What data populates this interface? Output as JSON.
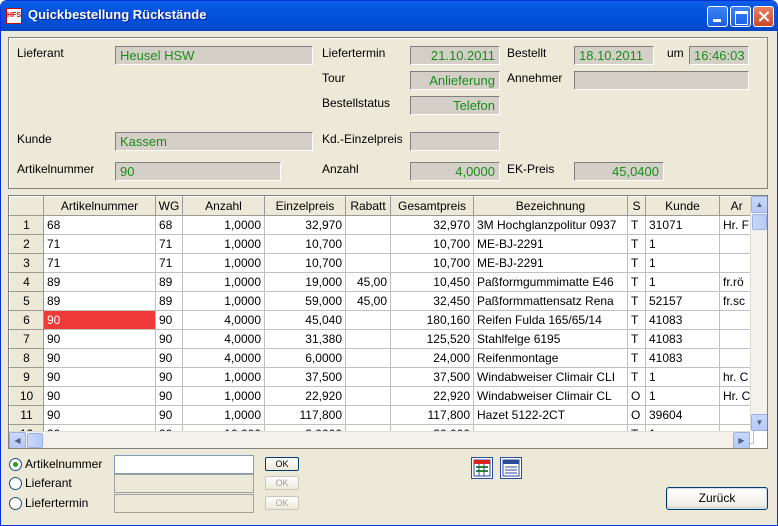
{
  "window": {
    "title": "Quickbestellung Rückstände",
    "icon_text": "HFS"
  },
  "header": {
    "lieferant_label": "Lieferant",
    "lieferant_value": "Heusel HSW",
    "liefertermin_label": "Liefertermin",
    "liefertermin_value": "21.10.2011",
    "bestellt_label": "Bestellt",
    "bestellt_date": "18.10.2011",
    "um_label": "um",
    "bestellt_time": "16:46:03",
    "tour_label": "Tour",
    "tour_value": "Anlieferung",
    "annehmer_label": "Annehmer",
    "annehmer_value": "",
    "bestellstatus_label": "Bestellstatus",
    "bestellstatus_value": "Telefon",
    "kunde_label": "Kunde",
    "kunde_value": "Kassem",
    "kd_einzelpreis_label": "Kd.-Einzelpreis",
    "kd_einzelpreis_value": "",
    "artikelnummer_label": "Artikelnummer",
    "artikelnummer_value": "90",
    "anzahl_label": "Anzahl",
    "anzahl_value": "4,0000",
    "ek_preis_label": "EK-Preis",
    "ek_preis_value": "45,0400"
  },
  "grid": {
    "columns": [
      "",
      "Artikelnummer",
      "WG",
      "Anzahl",
      "Einzelpreis",
      "Rabatt",
      "Gesamtpreis",
      "Bezeichnung",
      "S",
      "Kunde",
      "Ar"
    ],
    "rows": [
      [
        "1",
        "68",
        "68",
        "1,0000",
        "32,970",
        "",
        "32,970",
        "3M Hochglanzpolitur 0937",
        "T",
        "31071",
        "Hr. F"
      ],
      [
        "2",
        "71",
        "71",
        "1,0000",
        "10,700",
        "",
        "10,700",
        "ME-BJ-2291",
        "T",
        "1",
        ""
      ],
      [
        "3",
        "71",
        "71",
        "1,0000",
        "10,700",
        "",
        "10,700",
        "ME-BJ-2291",
        "T",
        "1",
        ""
      ],
      [
        "4",
        "89",
        "89",
        "1,0000",
        "19,000",
        "45,00",
        "10,450",
        "Paßformgummimatte E46",
        "T",
        "1",
        "fr.rö"
      ],
      [
        "5",
        "89",
        "89",
        "1,0000",
        "59,000",
        "45,00",
        "32,450",
        "Paßformmattensatz Rena",
        "T",
        "52157",
        "fr.sc"
      ],
      [
        "6",
        "90",
        "90",
        "4,0000",
        "45,040",
        "",
        "180,160",
        "Reifen Fulda 165/65/14",
        "T",
        "41083",
        ""
      ],
      [
        "7",
        "90",
        "90",
        "4,0000",
        "31,380",
        "",
        "125,520",
        "Stahlfelge 6195",
        "T",
        "41083",
        ""
      ],
      [
        "8",
        "90",
        "90",
        "4,0000",
        "6,0000",
        "",
        "24,000",
        "Reifenmontage",
        "T",
        "41083",
        ""
      ],
      [
        "9",
        "90",
        "90",
        "1,0000",
        "37,500",
        "",
        "37,500",
        "Windabweiser Climair CLI",
        "T",
        "1",
        "hr. C"
      ],
      [
        "10",
        "90",
        "90",
        "1,0000",
        "22,920",
        "",
        "22,920",
        "Windabweiser Climair  CL",
        "O",
        "1",
        "Hr. C"
      ],
      [
        "11",
        "90",
        "90",
        "1,0000",
        "117,800",
        "",
        "117,800",
        "Hazet 5122-2CT",
        "O",
        "39604",
        ""
      ],
      [
        "12",
        "90",
        "90",
        "10,000",
        "3,0000",
        "",
        "30,000",
        "",
        "T",
        "1",
        ""
      ]
    ],
    "selected_row": 6
  },
  "search": {
    "options": [
      {
        "label": "Artikelnummer",
        "checked": true,
        "value": ""
      },
      {
        "label": "Lieferant",
        "checked": false,
        "value": ""
      },
      {
        "label": "Liefertermin",
        "checked": false,
        "value": ""
      }
    ],
    "ok_label": "OK"
  },
  "footer": {
    "zurueck_label": "Zurück"
  },
  "colors": {
    "field_text": "#1a8c1a",
    "selected_cell": "#f03a3a",
    "title_bar": "#0554e0"
  }
}
